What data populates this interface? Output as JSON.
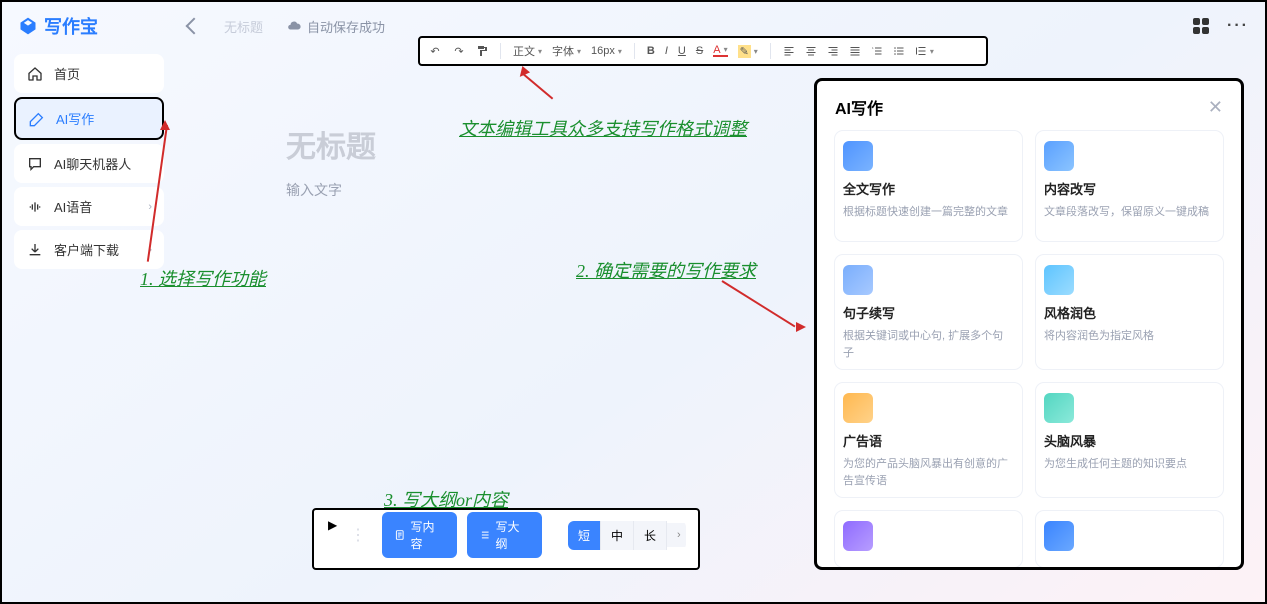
{
  "app": {
    "name": "写作宝",
    "back_untitled": "无标题",
    "autosave": "自动保存成功"
  },
  "sidebar": {
    "items": [
      {
        "label": "首页",
        "icon": "home-icon"
      },
      {
        "label": "AI写作",
        "icon": "pen-icon"
      },
      {
        "label": "AI聊天机器人",
        "icon": "chat-icon"
      },
      {
        "label": "AI语音",
        "icon": "voice-icon",
        "chevron": "›"
      },
      {
        "label": "客户端下载",
        "icon": "download-icon",
        "chevron": "›"
      }
    ]
  },
  "toolbar": {
    "text_style": "正文",
    "font_family": "字体",
    "font_size": "16px",
    "bold": "B",
    "italic": "I",
    "underline": "U",
    "strike": "S",
    "font_color": "A"
  },
  "editor": {
    "title": "无标题",
    "placeholder": "输入文字"
  },
  "bottom": {
    "write_content": "写内容",
    "write_outline": "写大纲",
    "len_short": "短",
    "len_mid": "中",
    "len_long": "长"
  },
  "ai_panel": {
    "title": "AI写作",
    "cards": [
      {
        "title": "全文写作",
        "desc": "根据标题快速创建一篇完整的文章",
        "color": "#4f94ff"
      },
      {
        "title": "内容改写",
        "desc": "文章段落改写，保留原义一键成稿",
        "color": "#5aa0ff"
      },
      {
        "title": "句子续写",
        "desc": "根据关键词或中心句, 扩展多个句子",
        "color": "#7aaefc"
      },
      {
        "title": "风格润色",
        "desc": "将内容润色为指定风格",
        "color": "#5ec4ff"
      },
      {
        "title": "广告语",
        "desc": "为您的产品头脑风暴出有创意的广告宣传语",
        "color": "#ffb84f"
      },
      {
        "title": "头脑风暴",
        "desc": "为您生成任何主题的知识要点",
        "color": "#53d6c1"
      },
      {
        "title": "",
        "desc": "",
        "color": "#8f6bff"
      },
      {
        "title": "",
        "desc": "",
        "color": "#3a84ff"
      }
    ]
  },
  "annotations": {
    "a1": "1. 选择写作功能",
    "a2": "2. 确定需要的写作要求",
    "a3": "3. 写大纲or内容",
    "toolbar_note": "文本编辑工具众多支持写作格式调整"
  }
}
